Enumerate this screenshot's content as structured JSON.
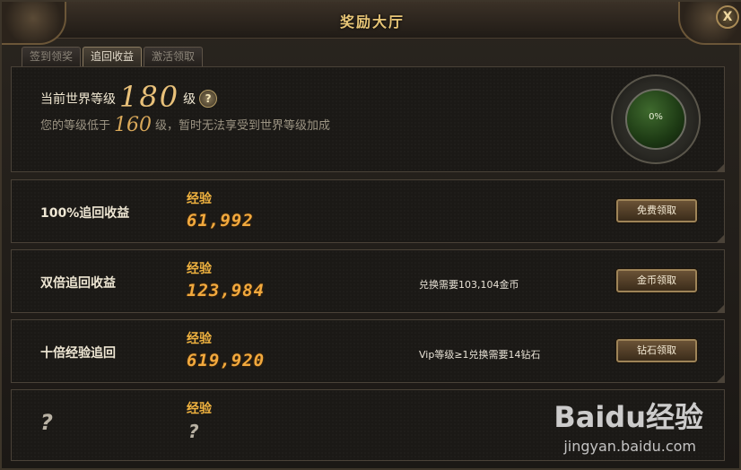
{
  "window": {
    "title": "奖励大厅",
    "close_label": "X"
  },
  "tabs": [
    {
      "label": "签到领奖",
      "active": false
    },
    {
      "label": "追回收益",
      "active": true
    },
    {
      "label": "激活领取",
      "active": false
    }
  ],
  "world_level": {
    "prefix": "当前世界等级",
    "value": "180",
    "unit": "级",
    "help": "?",
    "sub_prefix": "您的等级低于",
    "sub_value": "160",
    "sub_suffix": "级，暂时无法享受到世界等级加成",
    "orb_percent": "0%",
    "orb_fill_fraction": 0
  },
  "rows": [
    {
      "label": "100%追回收益",
      "exp_label": "经验",
      "exp_value": "61,992",
      "cost": "",
      "button": "免费领取"
    },
    {
      "label": "双倍追回收益",
      "exp_label": "经验",
      "exp_value": "123,984",
      "cost": "兑换需要103,104金币",
      "button": "金币领取"
    },
    {
      "label": "十倍经验追回",
      "exp_label": "经验",
      "exp_value": "619,920",
      "cost": "Vip等级≥1兑换需要14钻石",
      "button": "钻石领取"
    },
    {
      "label": "?",
      "exp_label": "经验",
      "exp_value": "?"
    }
  ],
  "watermark": {
    "logo": "Baidu经验",
    "url": "jingyan.baidu.com"
  },
  "colors": {
    "accent_gold": "#e8c677",
    "exp_orange": "#f2a93e",
    "orb_green": "#3f6a2e"
  }
}
